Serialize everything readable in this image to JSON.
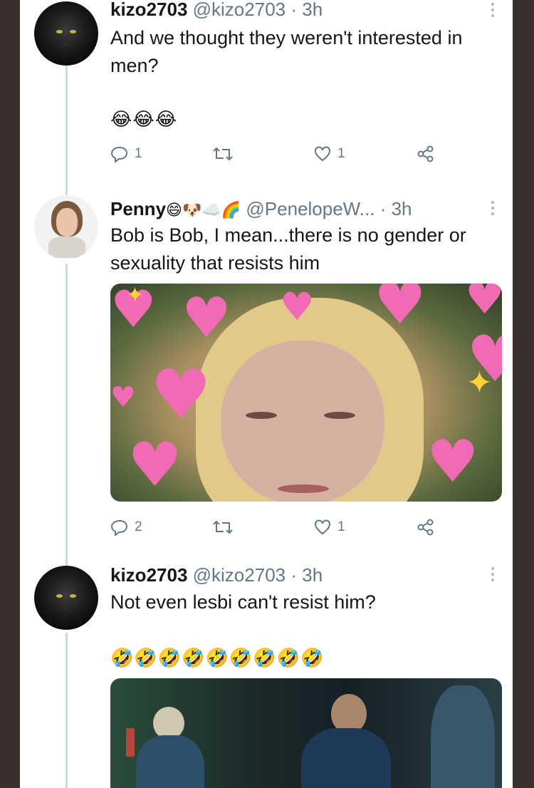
{
  "tweets": [
    {
      "name": "kizo2703",
      "handle": "@kizo2703",
      "time": "· 3h",
      "text": "And we thought they weren't interested in men?",
      "emoji": "😂😂😂",
      "replies": "1",
      "retweets": "",
      "likes": "1"
    },
    {
      "name": "Penny",
      "name_emoji": "😄🐶☁️🌈",
      "handle": "@PenelopeW...",
      "time": "· 3h",
      "text": "Bob is Bob, I mean...there is no gender or sexuality that resists him",
      "replies": "2",
      "retweets": "",
      "likes": "1"
    },
    {
      "name": "kizo2703",
      "handle": "@kizo2703",
      "time": "· 3h",
      "text": "Not even lesbi can't resist him?",
      "emoji": "🤣🤣🤣🤣🤣🤣🤣🤣🤣"
    }
  ],
  "icons": {
    "reply": "reply-icon",
    "retweet": "retweet-icon",
    "like": "heart-icon",
    "share": "share-icon",
    "more": "more-vertical-icon"
  },
  "colors": {
    "text": "#14171a",
    "secondary": "#657786",
    "thread_line": "#cfd9de",
    "frame": "#3a2f2f"
  }
}
